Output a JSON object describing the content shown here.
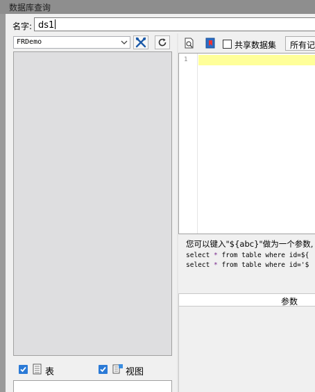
{
  "window": {
    "title": "数据库查询"
  },
  "name_field": {
    "label": "名字:",
    "value": "ds1"
  },
  "left": {
    "datasource": "FRDemo",
    "filters": [
      {
        "label": "表",
        "checked": true
      },
      {
        "label": "视图",
        "checked": true
      }
    ]
  },
  "right": {
    "share_label": "共享数据集",
    "all_button": "所有记",
    "editor": {
      "line_numbers": [
        "1"
      ]
    },
    "hint": {
      "line1": "您可以键入\"${abc}\"做为一个参数,",
      "code1_pre": "select ",
      "code1_star": "*",
      "code1_post": " from table where id=${",
      "code2_pre": "select ",
      "code2_star": "*",
      "code2_post": " from table where id='$"
    },
    "params_header": "参数"
  },
  "colors": {
    "accent": "#2b7ad6",
    "line_highlight": "#ffff99"
  }
}
